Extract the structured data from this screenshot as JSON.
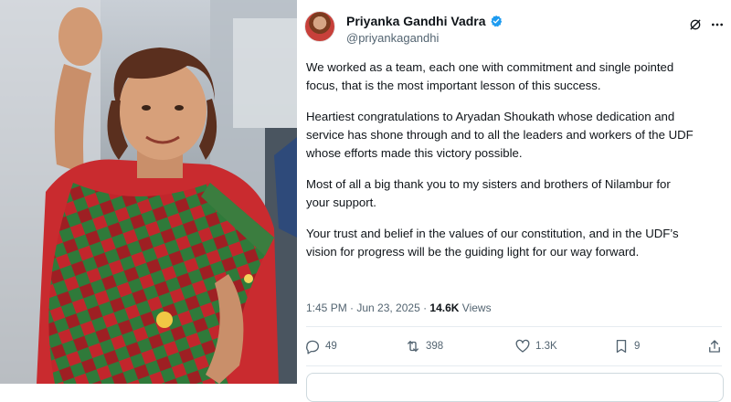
{
  "photo": {
    "alt_icon": "waving-person-photo"
  },
  "tweet": {
    "author": {
      "name": "Priyanka Gandhi Vadra",
      "handle": "@priyankagandhi",
      "verified": true
    },
    "paragraphs": [
      "We worked as a team, each one with commitment and single pointed\nfocus, that is the most important lesson of this success.",
      "Heartiest congratulations to Aryadan Shoukath whose dedication and\nservice has shone through and to all the leaders and workers of the UDF\nwhose efforts made this victory possible.",
      "Most of all a big thank you to my sisters and brothers of Nilambur for\nyour support.",
      "Your trust and belief in the values of our constitution, and in the UDF’s\nvision for progress will be the guiding light for our way forward."
    ],
    "timestamp": "1:45 PM · Jun 23, 2025 · ",
    "views_count": "14.6K",
    "views_label": " Views",
    "actions": {
      "replies": "49",
      "reposts": "398",
      "likes": "1.3K",
      "bookmarks": "9"
    }
  },
  "colors": {
    "text": "#0f1419",
    "muted": "#536471",
    "verified_blue": "#1d9bf0",
    "divider": "#e6ecf0"
  }
}
